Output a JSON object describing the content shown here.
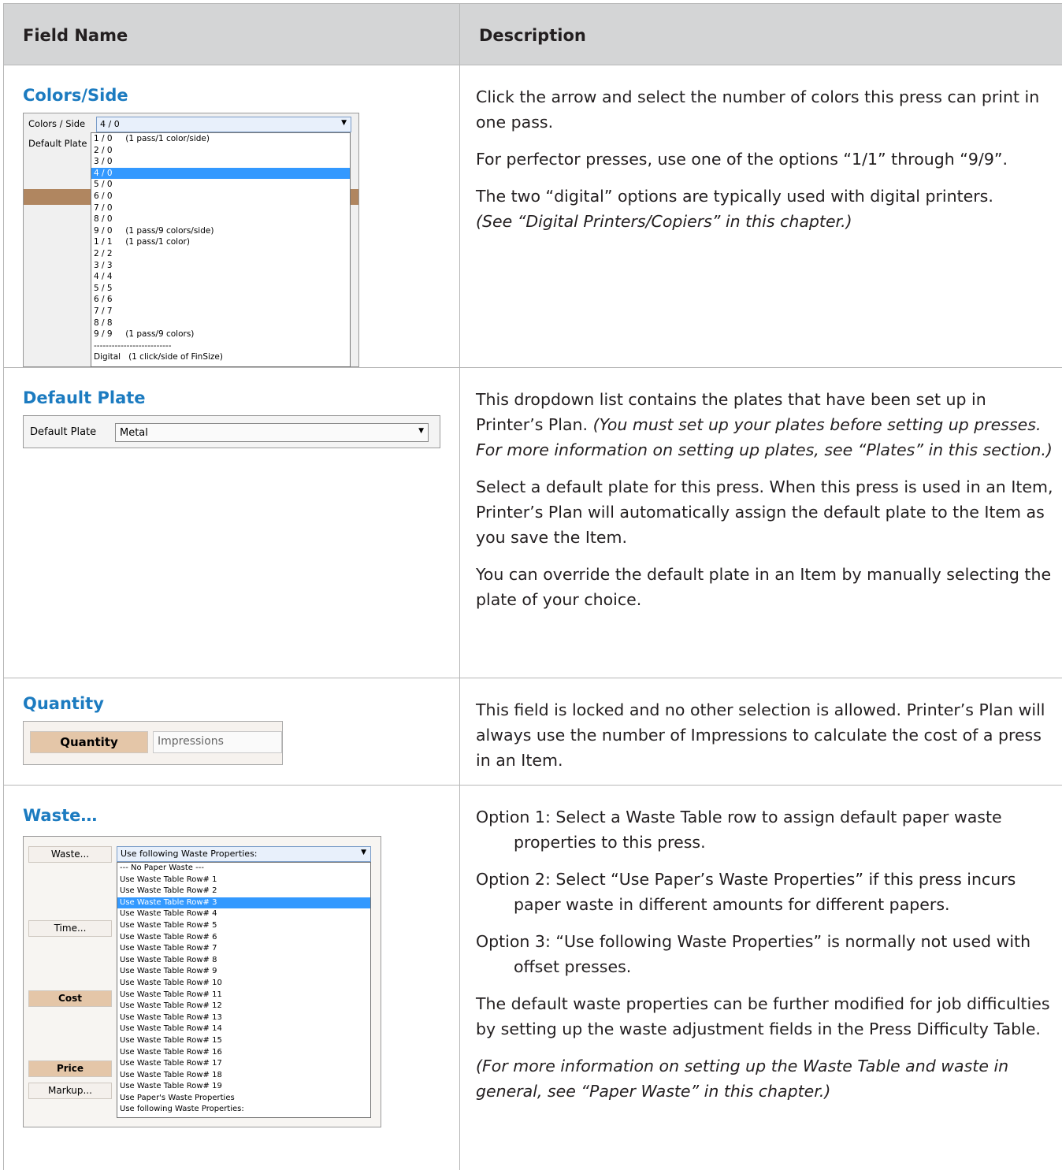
{
  "table": {
    "header": {
      "col1": "Field Name",
      "col2": "Description"
    }
  },
  "rows": {
    "colors": {
      "title": "Colors/Side",
      "ui": {
        "label": "Colors / Side",
        "default_plate_label": "Default Plate",
        "selected_value": "4 / 0",
        "options": [
          "1 / 0     (1 pass/1 color/side)",
          "2 / 0",
          "3 / 0",
          "4 / 0",
          "5 / 0",
          "6 / 0",
          "7 / 0",
          "8 / 0",
          "9 / 0     (1 pass/9 colors/side)",
          "1 / 1     (1 pass/1 color)",
          "2 / 2",
          "3 / 3",
          "4 / 4",
          "5 / 5",
          "6 / 6",
          "7 / 7",
          "8 / 8",
          "9 / 9     (1 pass/9 colors)",
          "--------------------------",
          "Digital   (1 click/side of FinSize)"
        ],
        "selected_index": 3
      },
      "desc": {
        "p1": "Click the arrow and select the number of colors this press can print in one pass.",
        "p2": "For perfector presses, use one of the options “1/1” through “9/9”.",
        "p3": "The two “digital” options are typically used with digital printers.",
        "p3_italic": "(See “Digital Printers/Copiers” in this chapter.)"
      }
    },
    "plate": {
      "title": "Default Plate",
      "ui": {
        "label": "Default Plate",
        "value": "Metal"
      },
      "desc": {
        "p1": "This dropdown list contains the plates that have been set up in Printer’s Plan.",
        "p1_italic": "(You must set up your plates before setting up presses. For more information on setting up plates, see “Plates” in this section.)",
        "p2": "Select a default plate for this press. When this press is used in an Item, Printer’s Plan will automatically assign the default plate to the Item as you save the Item.",
        "p3": "You can override the default plate in an Item by manually selecting the plate of your choice."
      }
    },
    "quantity": {
      "title": "Quantity",
      "ui": {
        "button": "Quantity",
        "value": "Impressions"
      },
      "desc": {
        "p1": "This field is locked and no other selection is allowed. Printer’s Plan will always use the number of Impressions to calculate the cost of a press in an Item."
      }
    },
    "waste": {
      "title": "Waste…",
      "ui": {
        "buttons": {
          "waste": "Waste...",
          "time": "Time...",
          "cost": "Cost",
          "price": "Price",
          "markup": "Markup..."
        },
        "selected_value": "Use following Waste Properties:",
        "options": [
          "--- No Paper Waste ---",
          "Use Waste Table Row# 1",
          "Use Waste Table Row# 2",
          "Use Waste Table Row# 3",
          "Use Waste Table Row# 4",
          "Use Waste Table Row# 5",
          "Use Waste Table Row# 6",
          "Use Waste Table Row# 7",
          "Use Waste Table Row# 8",
          "Use Waste Table Row# 9",
          "Use Waste Table Row# 10",
          "Use Waste Table Row# 11",
          "Use Waste Table Row# 12",
          "Use Waste Table Row# 13",
          "Use Waste Table Row# 14",
          "Use Waste Table Row# 15",
          "Use Waste Table Row# 16",
          "Use Waste Table Row# 17",
          "Use Waste Table Row# 18",
          "Use Waste Table Row# 19",
          "Use Paper's Waste Properties",
          "Use following Waste Properties:"
        ],
        "selected_index": 3
      },
      "desc": {
        "o1": "Option 1: Select a Waste Table row to assign default paper waste properties to this press.",
        "o2": "Option 2: Select “Use Paper’s Waste Properties” if this press incurs paper waste in different amounts for different papers.",
        "o3": "Option 3: “Use following Waste Properties” is normally not used with offset presses.",
        "p4": "The default waste properties can be further modified for job difficulties by setting up the waste adjustment fields in the Press Difficulty Table.",
        "p5_italic": "(For more information on setting up the Waste Table and waste in general, see “Paper Waste” in this chapter.)"
      }
    }
  },
  "colors": {
    "heading_blue": "#1c7bc0",
    "header_bg": "#d4d5d6",
    "list_highlight": "#3399ff",
    "tan_button": "#e4c6a8"
  }
}
